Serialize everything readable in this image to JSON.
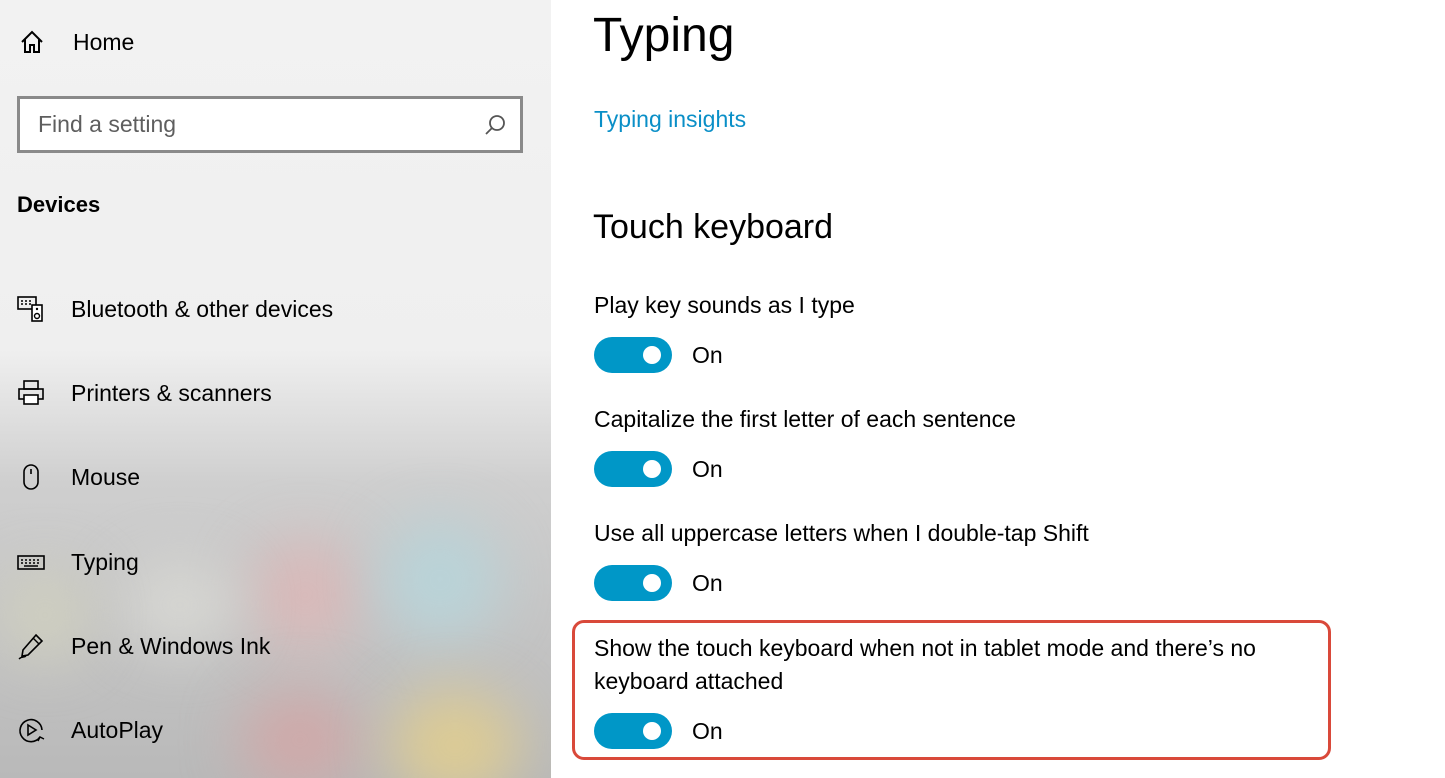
{
  "sidebar": {
    "home_label": "Home",
    "home_icon": "home-icon",
    "search_placeholder": "Find a setting",
    "search_icon": "search-icon",
    "section_title": "Devices",
    "items": [
      {
        "label": "Bluetooth & other devices",
        "icon": "bluetooth-devices-icon"
      },
      {
        "label": "Printers & scanners",
        "icon": "printer-icon"
      },
      {
        "label": "Mouse",
        "icon": "mouse-icon"
      },
      {
        "label": "Typing",
        "icon": "keyboard-icon"
      },
      {
        "label": "Pen & Windows Ink",
        "icon": "pen-icon"
      },
      {
        "label": "AutoPlay",
        "icon": "autoplay-icon"
      }
    ]
  },
  "main": {
    "title": "Typing",
    "insights_link": "Typing insights",
    "touch_keyboard_heading": "Touch keyboard",
    "settings": [
      {
        "label": "Play key sounds as I type",
        "state": "On",
        "enabled": true
      },
      {
        "label": "Capitalize the first letter of each sentence",
        "state": "On",
        "enabled": true
      },
      {
        "label": "Use all uppercase letters when I double-tap Shift",
        "state": "On",
        "enabled": true
      },
      {
        "label": "Show the touch keyboard when not in tablet mode and there’s no keyboard attached",
        "state": "On",
        "enabled": true
      }
    ]
  },
  "colors": {
    "accent": "#0097c7",
    "link": "#0a8fc7",
    "highlight_border": "#d9493a"
  }
}
